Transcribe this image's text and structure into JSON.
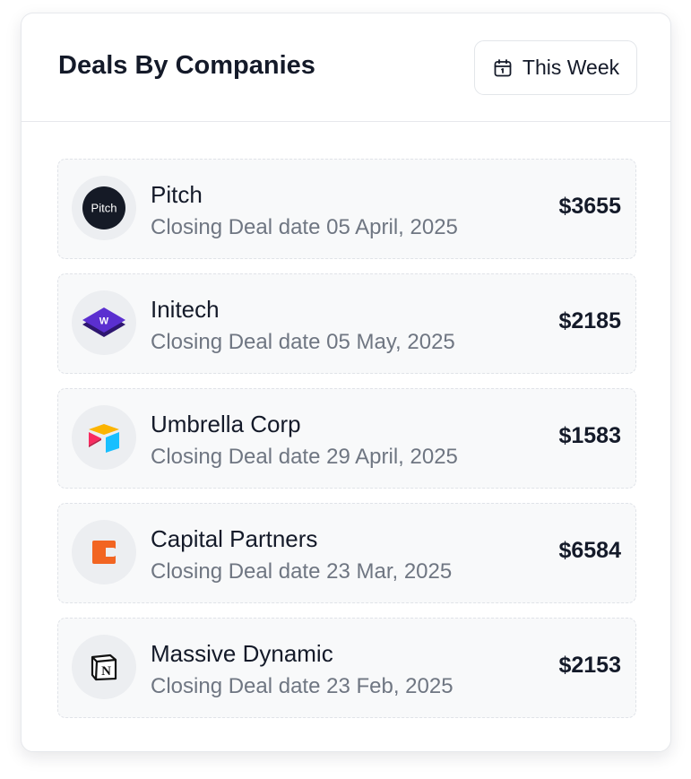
{
  "widget": {
    "title": "Deals By Companies",
    "period_button": {
      "icon": "calendar-icon",
      "label": "This Week"
    }
  },
  "deals": [
    {
      "company": "Pitch",
      "logo": "pitch-logo",
      "logo_text": "Pitch",
      "date_text": "Closing Deal date 05 April, 2025",
      "amount": "$3655"
    },
    {
      "company": "Initech",
      "logo": "initech-logo",
      "logo_text": "W",
      "date_text": "Closing Deal date 05 May, 2025",
      "amount": "$2185"
    },
    {
      "company": "Umbrella Corp",
      "logo": "umbrella-corp-logo",
      "date_text": "Closing Deal date 29 April, 2025",
      "amount": "$1583"
    },
    {
      "company": "Capital Partners",
      "logo": "capital-partners-logo",
      "date_text": "Closing Deal date 23 Mar, 2025",
      "amount": "$6584"
    },
    {
      "company": "Massive Dynamic",
      "logo": "massive-dynamic-logo",
      "logo_text": "N",
      "date_text": "Closing Deal date 23 Feb, 2025",
      "amount": "$2153"
    }
  ],
  "colors": {
    "text_primary": "#141a29",
    "text_secondary": "#6f7682",
    "row_background": "#f8f9fa",
    "border": "#e6e8ec",
    "initech_purple": "#5b2fd0",
    "capital_orange": "#f26522"
  }
}
